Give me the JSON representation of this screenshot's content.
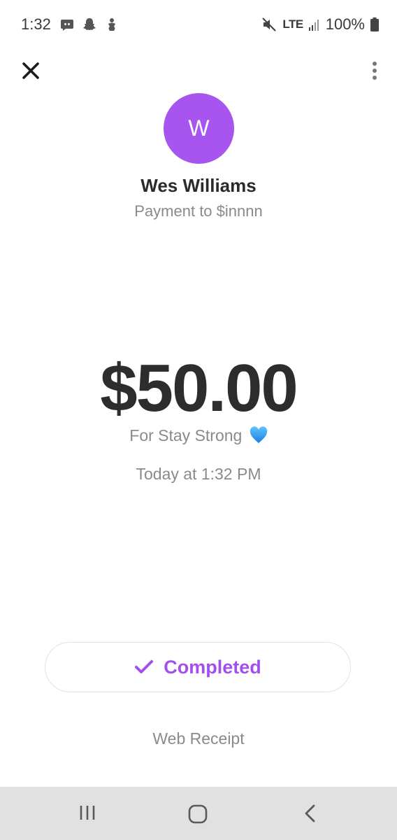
{
  "status_bar": {
    "time": "1:32",
    "network": "LTE",
    "battery": "100%",
    "icons": [
      "discord-icon",
      "snapchat-icon",
      "app-icon",
      "mute-icon",
      "signal-icon",
      "battery-icon"
    ]
  },
  "toolbar": {
    "close_icon": "close-icon",
    "more_icon": "more-vertical-icon"
  },
  "recipient": {
    "avatar_initial": "W",
    "avatar_color": "#a855f0",
    "name": "Wes Williams",
    "payment_to": "Payment to $innnn"
  },
  "payment": {
    "amount": "$50.00",
    "note": "For Stay Strong",
    "note_emoji": "blue-heart-icon",
    "timestamp": "Today at 1:32 PM"
  },
  "status": {
    "label": "Completed",
    "color": "#a34ff0",
    "icon": "check-icon"
  },
  "links": {
    "web_receipt": "Web Receipt"
  },
  "nav": {
    "items": [
      "recent-apps-icon",
      "home-icon",
      "back-icon"
    ]
  }
}
